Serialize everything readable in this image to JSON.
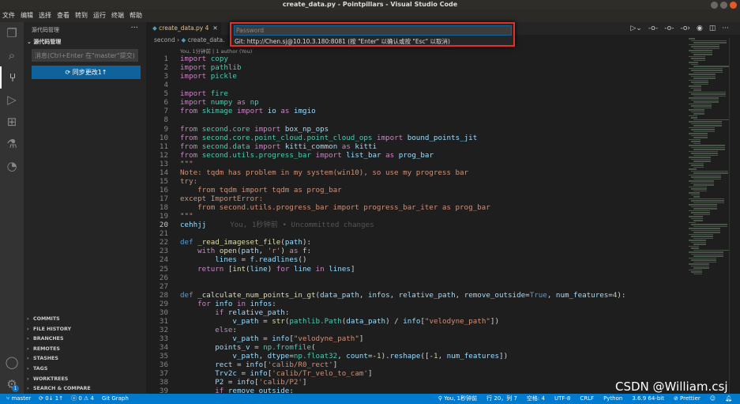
{
  "window": {
    "title": "create_data.py - Pointpillars - Visual Studio Code"
  },
  "menu": [
    "文件",
    "编辑",
    "选择",
    "查看",
    "转到",
    "运行",
    "终端",
    "帮助"
  ],
  "sidebar": {
    "title": "源代码管理",
    "section": "源代码管理",
    "message_placeholder": "消息(Ctrl+Enter 在\"master\"提交)",
    "sync_label": "同步更改1↑",
    "git_sections": [
      "COMMITS",
      "FILE HISTORY",
      "BRANCHES",
      "REMOTES",
      "STASHES",
      "TAGS",
      "WORKTREES",
      "SEARCH & COMPARE"
    ]
  },
  "activity": {
    "icons": [
      "files-icon",
      "search-icon",
      "source-control-icon",
      "run-debug-icon",
      "extensions-icon",
      "testing-icon",
      "git-graph-icon"
    ],
    "settings_badge": "1"
  },
  "tab": {
    "label": "create_data.py",
    "problems": "4"
  },
  "breadcrumb": [
    "second",
    "create_data."
  ],
  "codelens": "You, 1分钟前 | 1 author (You)",
  "quick_input": {
    "placeholder": "Password",
    "hint": "Git: http://Chen.sj@10.10.3.180:8081 (按 \"Enter\" 以确认或按 \"Esc\" 以取消)"
  },
  "editor": {
    "current_line": 20,
    "blame": "You, 1秒钟前 • Uncommitted changes",
    "lines": [
      "import copy",
      "import pathlib",
      "import pickle",
      "",
      "import fire",
      "import numpy as np",
      "from skimage import io as imgio",
      "",
      "from second.core import box_np_ops",
      "from second.core.point_cloud.point_cloud_ops import bound_points_jit",
      "from second.data import kitti_common as kitti",
      "from second.utils.progress_bar import list_bar as prog_bar",
      "\"\"\"",
      "Note: tqdm has problem in my system(win10), so use my progress bar",
      "try:",
      "    from tqdm import tqdm as prog_bar",
      "except ImportError:",
      "    from second.utils.progress_bar import progress_bar_iter as prog_bar",
      "\"\"\"",
      "cehhjj",
      "",
      "def _read_imageset_file(path):",
      "    with open(path, 'r') as f:",
      "        lines = f.readlines()",
      "    return [int(line) for line in lines]",
      "",
      "",
      "def _calculate_num_points_in_gt(data_path, infos, relative_path, remove_outside=True, num_features=4):",
      "    for info in infos:",
      "        if relative_path:",
      "            v_path = str(pathlib.Path(data_path) / info[\"velodyne_path\"])",
      "        else:",
      "            v_path = info[\"velodyne_path\"]",
      "        points_v = np.fromfile(",
      "            v_path, dtype=np.float32, count=-1).reshape([-1, num_features])",
      "        rect = info['calib/R0_rect']",
      "        Trv2c = info['calib/Tr_velo_to_cam']",
      "        P2 = info['calib/P2']",
      "        if remove_outside:"
    ]
  },
  "statusbar": {
    "branch": "master",
    "sync": "0↓ 1↑",
    "errors": "0",
    "warnings": "4",
    "git_graph": "Git Graph",
    "blame": "You, 1秒钟前",
    "position": "行 20，列 7",
    "spaces": "空格: 4",
    "encoding": "UTF-8",
    "eol": "CRLF",
    "language": "Python",
    "interpreter": "3.6.9 64-bit",
    "prettier": "Prettier"
  },
  "watermark": "CSDN @William.csj"
}
